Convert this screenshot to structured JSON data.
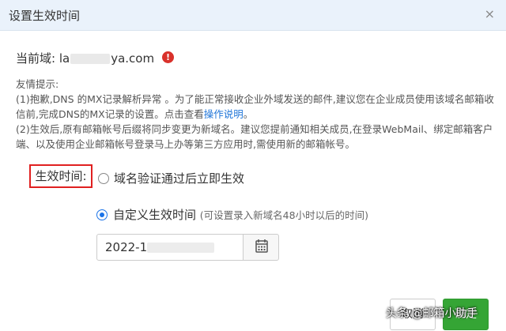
{
  "dialog": {
    "title": "设置生效时间",
    "close_symbol": "×"
  },
  "domain": {
    "label": "当前域:",
    "value_start": "la",
    "value_end": "ya.com"
  },
  "tips": {
    "heading": "友情提示:",
    "line1_prefix": "(1)抱歉,DNS 的MX记录解析异常 。为了能正常接收企业外域发送的邮件,建议您在企业成员使用该域名邮箱收信前,完成DNS的MX记录的设置。点击查看",
    "line1_link": "操作说明",
    "line1_suffix": "。",
    "line2": "(2)生效后,原有邮箱帐号后缀将同步变更为新域名。建议您提前通知相关成员,在登录WebMail、绑定邮箱客户端、以及使用企业邮箱帐号登录马上办等第三方应用时,需使用新的邮箱帐号。"
  },
  "effective_time": {
    "label": "生效时间:",
    "option_immediate": "域名验证通过后立即生效",
    "option_custom": "自定义生效时间",
    "option_custom_hint": "(可设置录入新域名48小时以后的时间)",
    "selected": "custom",
    "date_value_start": "2022-1"
  },
  "buttons": {
    "cancel": "取消",
    "ok": "确定"
  },
  "watermark": "头条 @邮箱小助手",
  "colors": {
    "header_bg": "#eaf2fb",
    "warning": "#d9312b",
    "link": "#1f75d8",
    "highlight_box": "#e02020",
    "radio_selected": "#1a73e8",
    "ok_button": "#35a535"
  }
}
